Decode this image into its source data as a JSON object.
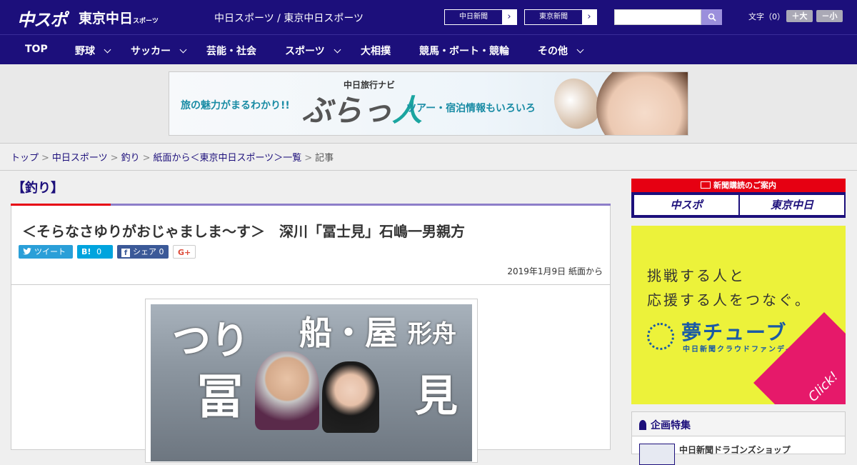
{
  "header": {
    "logo_primary": "中スポ",
    "logo_secondary": "東京中日",
    "logo_secondary_small": "スポーツ",
    "site_name": "中日スポーツ / 東京中日スポーツ",
    "external_links": [
      {
        "label": "中日新聞"
      },
      {
        "label": "東京新聞"
      }
    ],
    "search": {
      "placeholder": ""
    },
    "font_size": {
      "label": "文字（0）",
      "increase": "＋大",
      "decrease": "－小"
    }
  },
  "nav": {
    "items": [
      {
        "label": "TOP"
      },
      {
        "label": "野球"
      },
      {
        "label": "サッカー"
      },
      {
        "label": "芸能・社会"
      },
      {
        "label": "スポーツ"
      },
      {
        "label": "大相撲"
      },
      {
        "label": "競馬・ボート・競輪"
      },
      {
        "label": "その他"
      }
    ]
  },
  "banner": {
    "left_text": "旅の魅力がまるわかり!!",
    "top_text": "中日旅行ナビ",
    "main_text_a": "ぶらっ",
    "main_text_b": "人",
    "right_text": "ツアー・宿泊情報もいろいろ"
  },
  "breadcrumb": {
    "items": [
      "トップ",
      "中日スポーツ",
      "釣り",
      "紙面から＜東京中日スポーツ＞一覧"
    ],
    "current": "記事",
    "separator": ">"
  },
  "article": {
    "category": "【釣り】",
    "headline": "＜そらなさゆりがおじゃましま～す＞　深川「冨士見」石嶋一男親方",
    "share": {
      "tweet": "ツイート",
      "hatena_label": "B!",
      "hatena_count": "0",
      "facebook_label": "シェア",
      "facebook_count": "0",
      "gplus": "G+"
    },
    "date": "2019年1月9日 紙面から",
    "photo_text": [
      "つり",
      "船・屋",
      "形舟",
      "冨",
      "見"
    ]
  },
  "sidebar": {
    "subscribe": {
      "heading": "新聞購読のご案内",
      "logo_a": "中スポ",
      "logo_b": "東京中日"
    },
    "yume": {
      "line1": "挑戦する人と",
      "line2": "応援する人をつなぐ。",
      "logo": "夢チューブ",
      "sub": "中日新聞クラウドファンディング",
      "click": "Click!"
    },
    "feature": {
      "heading": "企画特集",
      "item": "中日新聞ドラゴンズショップ"
    }
  },
  "colors": {
    "brand_navy": "#1c0f7b",
    "accent_red": "#e60012",
    "yume_yellow": "#ecf23a"
  }
}
